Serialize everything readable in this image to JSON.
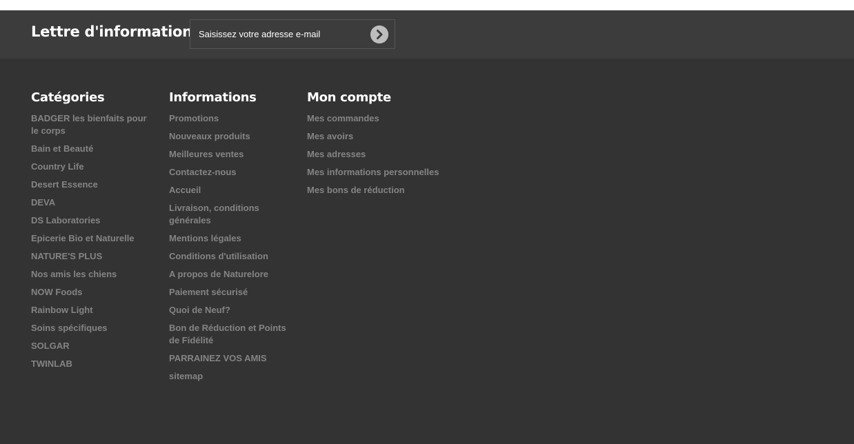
{
  "newsletter": {
    "title": "Lettre d'informations",
    "placeholder": "Saisissez votre adresse e-mail",
    "submit_icon": "chevron-right-circle-icon"
  },
  "footer": {
    "categories": {
      "heading": "Catégories",
      "items": [
        "BADGER les bienfaits pour le corps",
        "Bain et Beauté",
        "Country Life",
        "Desert Essence",
        "DEVA",
        "DS Laboratories",
        "Epicerie Bio et Naturelle",
        "NATURE'S PLUS",
        "Nos amis les chiens",
        "NOW Foods",
        "Rainbow Light",
        "Soins spécifiques",
        "SOLGAR",
        "TWINLAB"
      ]
    },
    "informations": {
      "heading": "Informations",
      "items": [
        "Promotions",
        "Nouveaux produits",
        "Meilleures ventes",
        "Contactez-nous",
        "Accueil",
        "Livraison, conditions générales",
        "Mentions légales",
        "Conditions d'utilisation",
        "A propos de Naturelore",
        "Paiement sécurisé",
        "Quoi de Neuf?",
        "Bon de Réduction et Points de Fidélité",
        "PARRAINEZ VOS AMIS",
        "sitemap"
      ]
    },
    "account": {
      "heading": "Mon compte",
      "items": [
        "Mes commandes",
        "Mes avoirs",
        "Mes adresses",
        "Mes informations personnelles",
        "Mes bons de réduction"
      ]
    }
  },
  "colors": {
    "newsletter_bg": "#3c3c3c",
    "footer_bg": "#333333",
    "heading": "#ffffff",
    "link": "#848484"
  }
}
